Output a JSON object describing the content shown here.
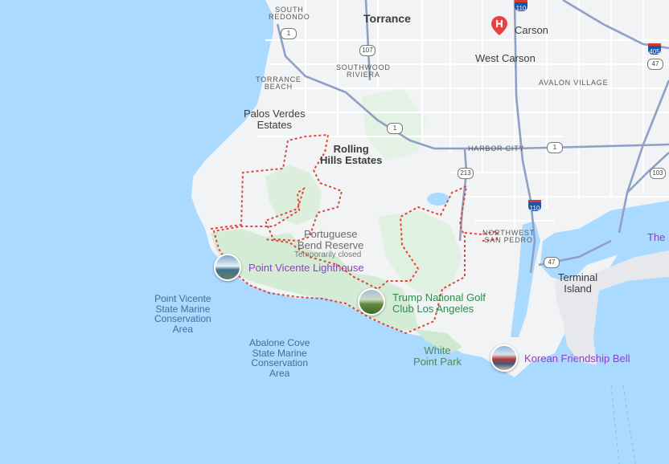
{
  "map": {
    "cities": {
      "torrance": "Torrance",
      "carson": "Carson",
      "west_carson": "West Carson",
      "palos_verdes_estates": "Palos Verdes\nEstates",
      "rolling_hills_estates": "Rolling\nHills Estates",
      "terminal_island": "Terminal\nIsland"
    },
    "neighborhoods": {
      "south_redondo": "SOUTH\nREDONDO",
      "southwood_riviera": "SOUTHWOOD\nRIVIERA",
      "torrance_beach": "TORRANCE\nBEACH",
      "avalon_village": "AVALON VILLAGE",
      "harbor_city": "HARBOR CITY",
      "northwest_san_pedro": "NORTHWEST\nSAN PEDRO"
    },
    "parks": {
      "portuguese_bend": "Portuguese\nBend Reserve",
      "portuguese_bend_status": "Temporarily closed",
      "white_point": "White\nPoint Park"
    },
    "water": {
      "point_vicente_smca": "Point Vicente\nState Marine\nConservation\nArea",
      "abalone_cove_smca": "Abalone Cove\nState Marine\nConservation\nArea"
    },
    "pois": {
      "point_vicente_lighthouse": "Point Vicente Lighthouse",
      "trump_golf": "Trump National Golf\nClub Los Angeles",
      "korean_bell": "Korean Friendship Bell",
      "edge_label": "The"
    },
    "routes": {
      "ca1_a": "1",
      "ca1_b": "1",
      "ca1_c": "1",
      "ca107": "107",
      "ca213": "213",
      "ca47": "47",
      "ca103": "103",
      "ca47_b": "47",
      "ca110_top": "110",
      "i110": "110",
      "i405": "405"
    },
    "colors": {
      "water": "#aadaff",
      "land": "#f1f3f4",
      "park": "#d4ecd6",
      "boundary": "#e0453a",
      "highway": "#8ea0c4",
      "poi": "#8e3fc7",
      "hospital": "#e8413e"
    },
    "icons": {
      "hospital": "hospital-pin-icon"
    }
  }
}
